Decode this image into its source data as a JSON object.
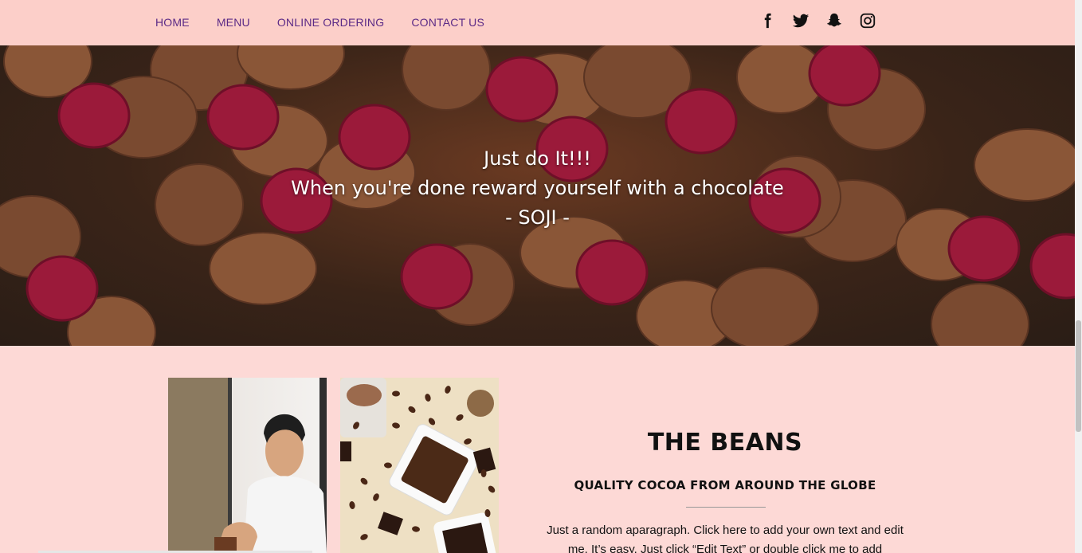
{
  "nav": {
    "items": [
      "HOME",
      "MENU",
      "ONLINE ORDERING",
      "CONTACT US"
    ],
    "link_color": "#5b2a86",
    "background": "#fccfc9"
  },
  "social": [
    "facebook-icon",
    "twitter-icon",
    "snapchat-icon",
    "instagram-icon"
  ],
  "hero": {
    "line1": "Just do It!!!",
    "line2": "When you're done reward yourself with a chocolate",
    "line3": "- SOJI -"
  },
  "beans": {
    "title": "THE BEANS",
    "subtitle": "QUALITY COCOA FROM AROUND THE GLOBE",
    "paragraph": "Just a random aparagraph. Click here to add your own text and edit me. It’s easy. Just click “Edit Text” or double click me to add"
  },
  "colors": {
    "page_background": "#fdd9d6",
    "text": "#111111"
  }
}
